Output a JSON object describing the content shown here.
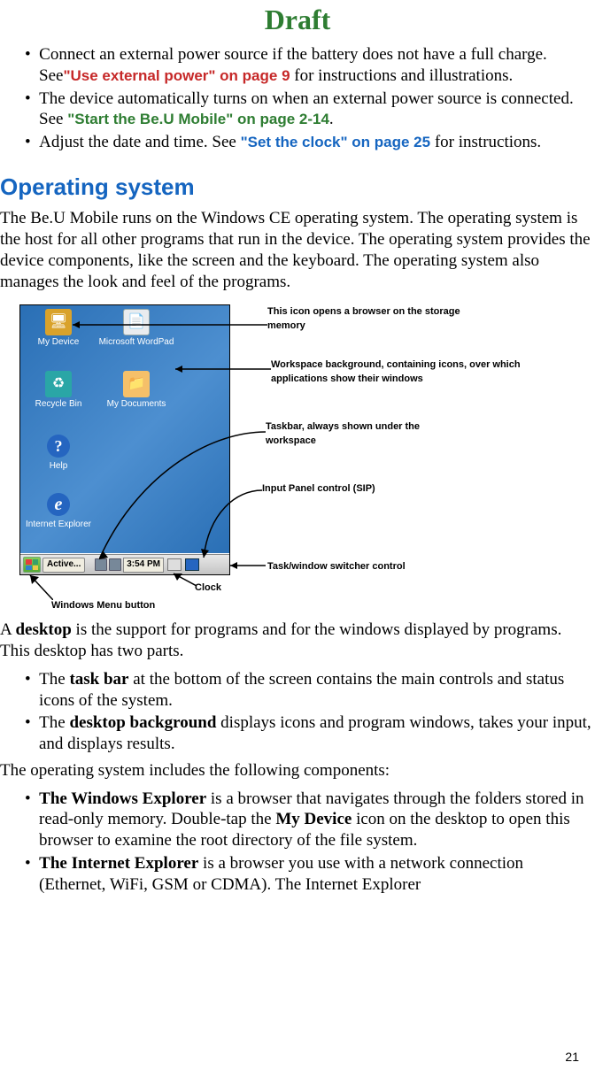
{
  "draft": "Draft",
  "intro_bullets": {
    "b1_pre": "Connect an external power source if the battery does not have a full charge. See",
    "b1_link": "\"Use external power\" on page 9",
    "b1_post": " for instructions and illustrations.",
    "b2_pre": "The device automatically turns on when an external power source is connected. See  ",
    "b2_link": "\"Start the Be.U Mobile\" on page 2-14",
    "b2_post": ".",
    "b3_pre": "Adjust the date and time. See ",
    "b3_link": "\"Set the clock\" on page 25",
    "b3_post": " for instructions."
  },
  "h2": "Operating system",
  "p_os": "The Be.U Mobile runs on the Windows CE operating system. The operating system is the host for all other programs that run in the device. The operating system provides the device components, like the screen and the keyboard. The operating system also manages the look and feel of the programs.",
  "screenshot": {
    "icons": {
      "my_device": "My Device",
      "wordpad": "Microsoft WordPad",
      "recycle": "Recycle Bin",
      "my_docs": "My Documents",
      "help": "Help",
      "ie": "Internet Explorer"
    },
    "taskbar": {
      "active": "Active...",
      "clock": "3:54 PM"
    }
  },
  "annotations": {
    "storage": "This icon opens a browser on the storage memory",
    "workspace": "Workspace background, containing icons, over which applications show their windows",
    "taskbar": "Taskbar, always shown under the workspace",
    "sip": "Input Panel control (SIP)",
    "switcher": "Task/window switcher control",
    "clock": "Clock",
    "winmenu": "Windows Menu button"
  },
  "desktop_intro": {
    "pre": "A ",
    "strong": "desktop",
    "post": " is the support for programs and for the windows displayed by programs. This desktop has two parts."
  },
  "desktop_bullets": {
    "tb_pre": "The ",
    "tb_strong": "task bar",
    "tb_post": " at the bottom of the screen contains the main controls and status icons of the system.",
    "bg_pre": "The ",
    "bg_strong": "desktop background",
    "bg_post": " displays icons and program windows, takes your input, and displays results."
  },
  "components_intro": "The operating system includes the following components:",
  "components": {
    "we_s1": "The Windows Explorer",
    "we_t1": " is a browser that navigates through the folders stored in read-only memory. Double-tap the ",
    "we_s2": "My Device",
    "we_t2": " icon on the desktop to open this browser to examine the root directory of the file system.",
    "ie_s1": "The Internet Explorer",
    "ie_t1": " is a browser you use with a network connection (Ethernet, WiFi, GSM or CDMA). The Internet Explorer"
  },
  "page_number": "21"
}
